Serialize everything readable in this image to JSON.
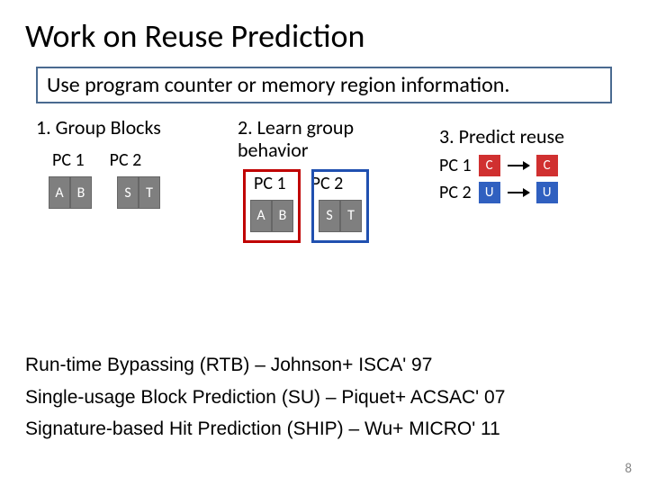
{
  "title": "Work on Reuse Prediction",
  "boxline": "Use program counter or memory region information.",
  "cols": {
    "h1": "1. Group Blocks",
    "h2": "2. Learn group behavior",
    "h3": "3. Predict reuse"
  },
  "pc": {
    "pc1": "PC 1",
    "pc2": "PC 2"
  },
  "blk": {
    "A": "A",
    "B": "B",
    "S": "S",
    "T": "T",
    "C": "C",
    "U": "U"
  },
  "refs": {
    "r1": "Run-time Bypassing (RTB) – Johnson+ ISCA' 97",
    "r2": "Single-usage Block Prediction (SU) – Piquet+ ACSAC' 07",
    "r3": "Signature-based Hit Prediction (SHIP) – Wu+ MICRO' 11"
  },
  "page": "8"
}
